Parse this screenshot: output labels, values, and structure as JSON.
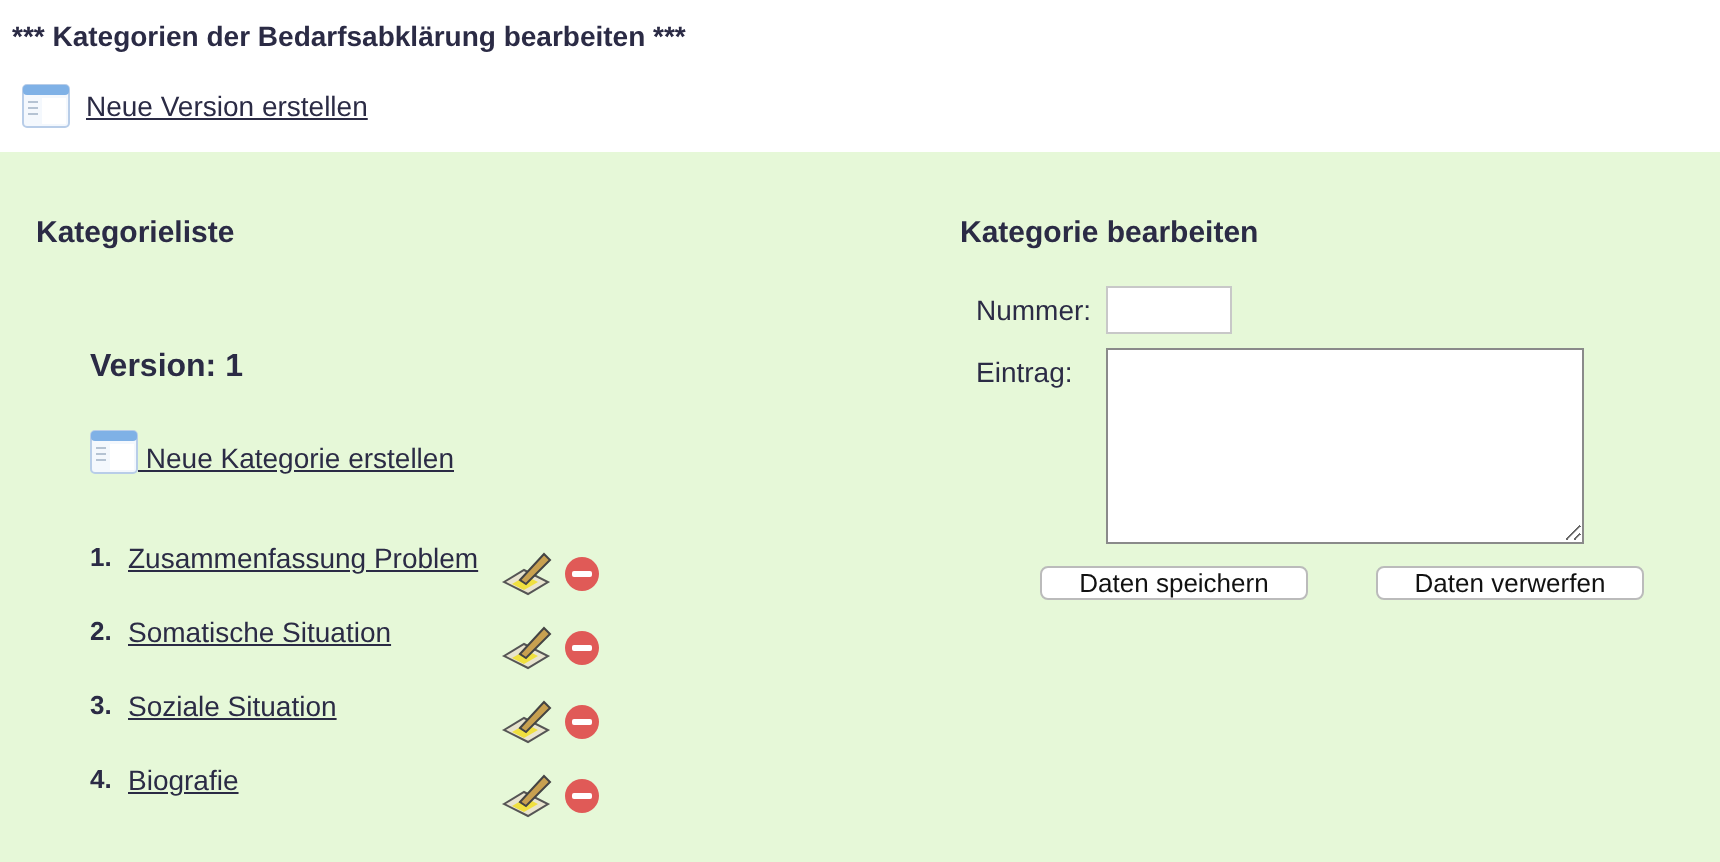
{
  "page_title": "*** Kategorien der Bedarfsabklärung bearbeiten ***",
  "new_version_link": "Neue Version erstellen",
  "category_list": {
    "heading": "Kategorieliste",
    "version": "Version: 1",
    "new_category_link": " Neue Kategorie erstellen",
    "items": [
      {
        "number": "1.",
        "label": "Zusammenfassung Problem"
      },
      {
        "number": "2.",
        "label": "Somatische Situation"
      },
      {
        "number": "3.",
        "label": "Soziale Situation"
      },
      {
        "number": "4.",
        "label": "Biografie"
      }
    ]
  },
  "editor": {
    "heading": "Kategorie bearbeiten",
    "number_label": "Nummer:",
    "entry_label": "Eintrag:",
    "buttons": [
      "Daten speichern",
      "Daten verwerfen"
    ]
  }
}
